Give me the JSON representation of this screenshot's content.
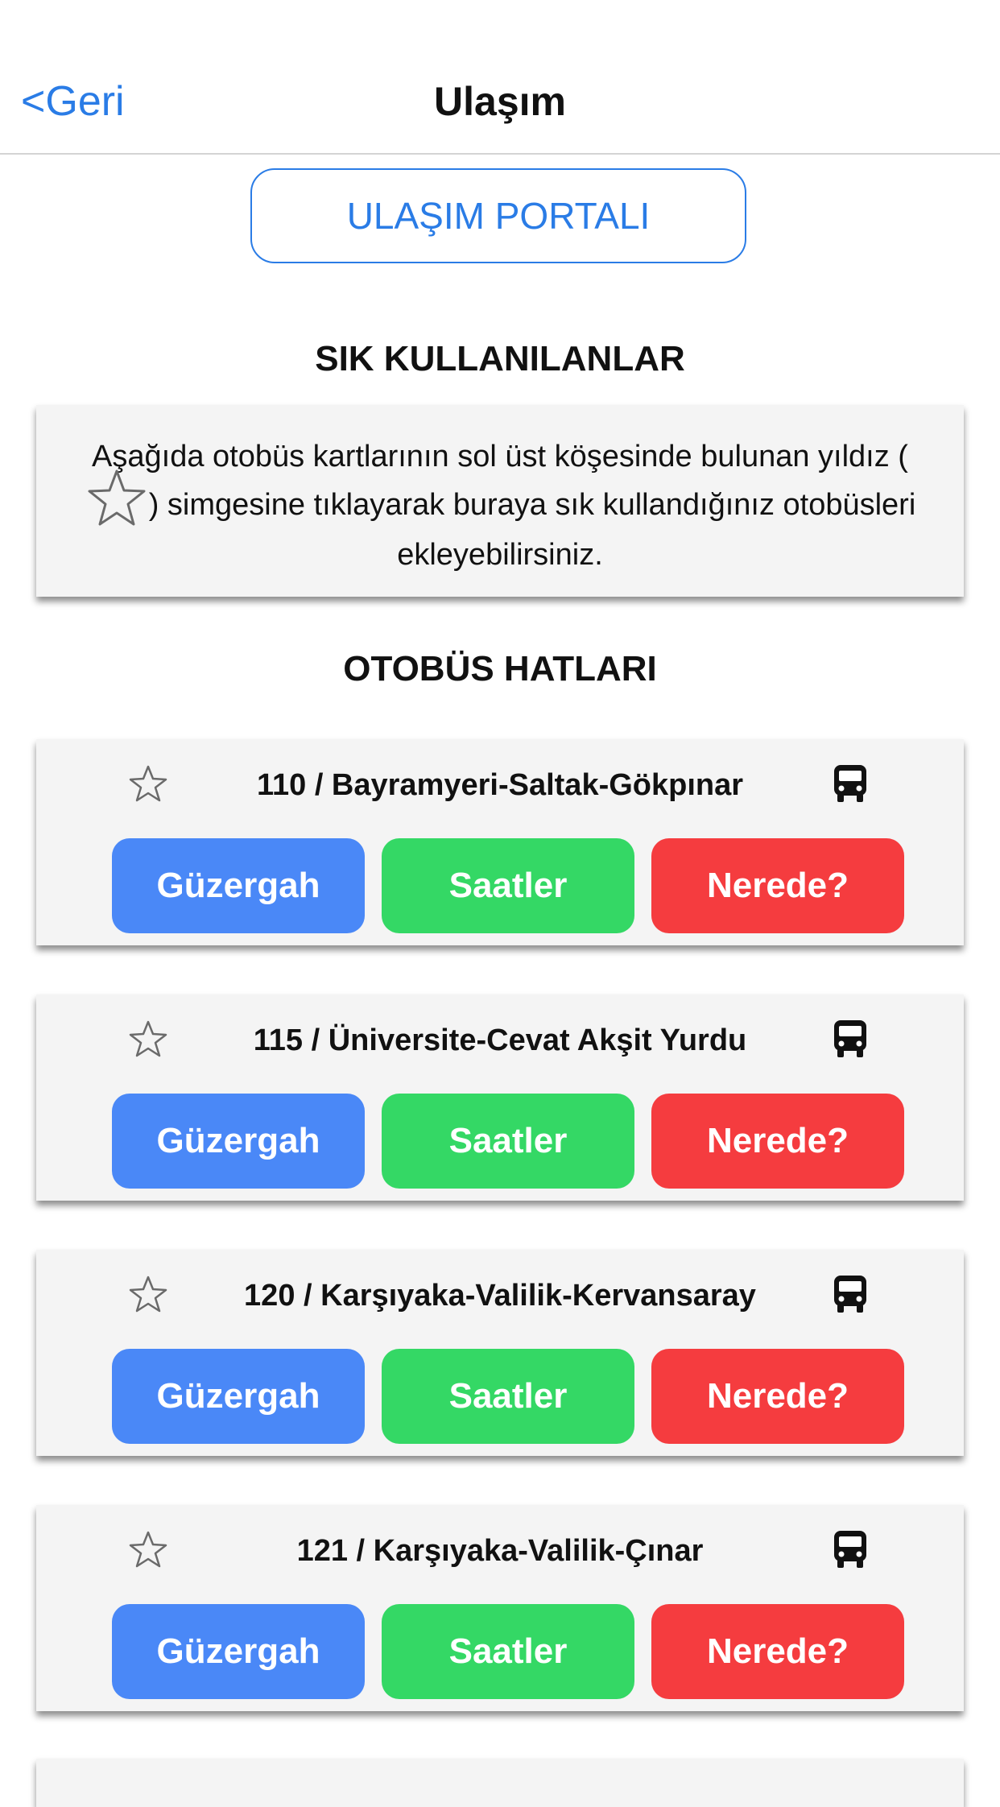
{
  "header": {
    "back_label": "<Geri",
    "title": "Ulaşım"
  },
  "portal_button": {
    "label": "ULAŞIM PORTALI"
  },
  "favorites": {
    "title": "SIK KULLANILANLAR",
    "info_before_star": "Aşağıda otobüs kartlarının sol üst köşesinde bulunan yıldız (",
    "info_after_star": ") simgesine tıklayarak buraya sık kullandığınız otobüsleri ekleyebilirsiniz."
  },
  "bus_lines": {
    "title": "OTOBÜS HATLARI",
    "route_label": "Güzergah",
    "hours_label": "Saatler",
    "where_label": "Nerede?",
    "items": [
      {
        "name": "110 / Bayramyeri-Saltak-Gökpınar"
      },
      {
        "name": "115 / Üniversite-Cevat Akşit Yurdu"
      },
      {
        "name": "120 / Karşıyaka-Valilik-Kervansaray"
      },
      {
        "name": "121 / Karşıyaka-Valilik-Çınar"
      }
    ]
  },
  "colors": {
    "link_blue": "#2a7ce6",
    "route_blue": "#4a88f7",
    "hours_green": "#34d865",
    "where_red": "#f53c3f",
    "card_bg": "#f4f4f4"
  }
}
